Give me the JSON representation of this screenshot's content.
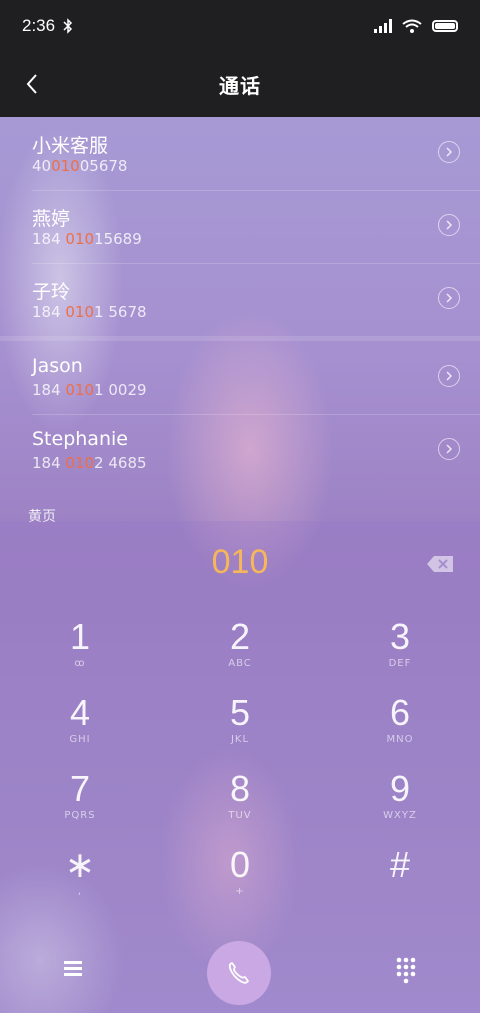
{
  "status": {
    "time": "2:36"
  },
  "header": {
    "title": "通话"
  },
  "contacts": [
    {
      "name": "小米客服",
      "num_pre": "40",
      "num_hl": "010",
      "num_post": "05678"
    },
    {
      "name": "燕婷",
      "num_pre": "184 ",
      "num_hl": "010",
      "num_post": "15689"
    },
    {
      "name": "子玲",
      "num_pre": "184 ",
      "num_hl": "010",
      "num_post": "1 5678"
    },
    {
      "name": "Jason",
      "num_pre": "184 ",
      "num_hl": "010",
      "num_post": "1 0029"
    },
    {
      "name": "Stephanie",
      "num_pre": "184 ",
      "num_hl": "010",
      "num_post": "2 4685"
    }
  ],
  "section_label": "黄页",
  "dialer": {
    "entered": "010",
    "keys": [
      {
        "digit": "1",
        "letters": "ꝏ"
      },
      {
        "digit": "2",
        "letters": "ABC"
      },
      {
        "digit": "3",
        "letters": "DEF"
      },
      {
        "digit": "4",
        "letters": "GHI"
      },
      {
        "digit": "5",
        "letters": "JKL"
      },
      {
        "digit": "6",
        "letters": "MNO"
      },
      {
        "digit": "7",
        "letters": "PQRS"
      },
      {
        "digit": "8",
        "letters": "TUV"
      },
      {
        "digit": "9",
        "letters": "WXYZ"
      },
      {
        "digit": "∗",
        "letters": ","
      },
      {
        "digit": "0",
        "letters": "+"
      },
      {
        "digit": "#",
        "letters": ""
      }
    ]
  },
  "colors": {
    "highlight": "#ee6f45",
    "entered_digits": "#f6b65a",
    "call_button": "#c9a8e4"
  },
  "icons": [
    "back-icon",
    "bluetooth-icon",
    "signal-icon",
    "wifi-icon",
    "battery-icon",
    "chevron-right-icon",
    "backspace-icon",
    "menu-icon",
    "phone-icon",
    "keypad-icon"
  ]
}
